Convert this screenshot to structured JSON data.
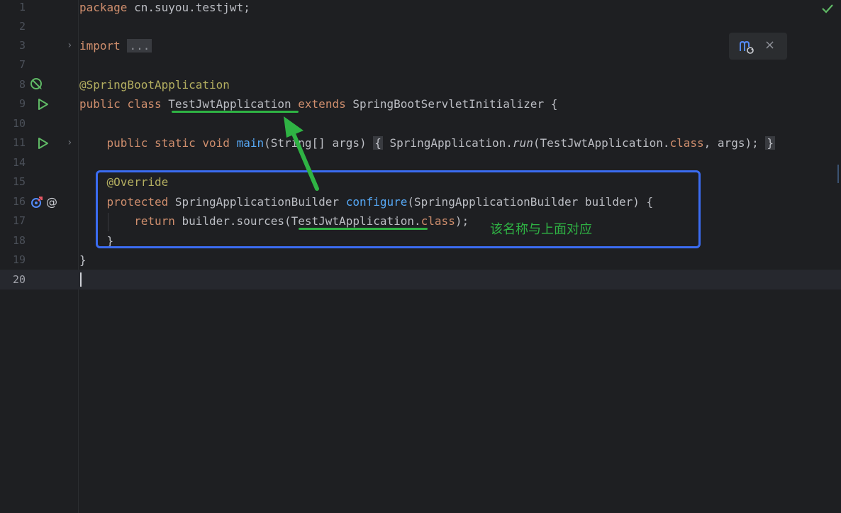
{
  "line_numbers": [
    "1",
    "2",
    "3",
    "7",
    "8",
    "9",
    "10",
    "11",
    "14",
    "15",
    "16",
    "17",
    "18",
    "19",
    "20"
  ],
  "code": {
    "l1": {
      "kw": "package",
      "rest": " cn.suyou.testjwt;"
    },
    "l3": {
      "kw": "import",
      "fold": "..."
    },
    "l8": {
      "annotation": "@SpringBootApplication"
    },
    "l9": {
      "kw1": "public",
      "kw2": "class",
      "classname": "TestJwtApplication",
      "kw3": "extends",
      "rest": " SpringBootServletInitializer {"
    },
    "l11": {
      "kw1": "public",
      "kw2": "static",
      "kw3": "void",
      "fn": "main",
      "params": "(String[] args)",
      "ob": "{",
      "call1": "SpringApplication.",
      "run": "run",
      "call2": "(TestJwtApplication.",
      "cls": "class",
      "call3": ", args);",
      "cb": "}"
    },
    "l15": {
      "annotation": "@Override"
    },
    "l16": {
      "kw": "protected",
      "type": " SpringApplicationBuilder ",
      "fn": "configure",
      "rest": "(SpringApplicationBuilder builder) {"
    },
    "l17": {
      "kw": "return",
      "pre": " builder.sources(",
      "name": "TestJwtApplication",
      "dot": ".",
      "cls": "class",
      "post": ");"
    },
    "l18": {
      "text": "}"
    },
    "l19": {
      "text": "}"
    }
  },
  "annotation_note": "该名称与上面对应",
  "popup": {
    "close": "×"
  },
  "colors": {
    "highlight_box": "#3b6cf2",
    "underline": "#2fb344",
    "arrow": "#2fb344"
  },
  "icons": [
    "checkmark-icon",
    "bean-icon",
    "run-icon",
    "override-icon",
    "at-icon",
    "fold-chevron-icon",
    "maven-reload-icon",
    "close-icon"
  ]
}
